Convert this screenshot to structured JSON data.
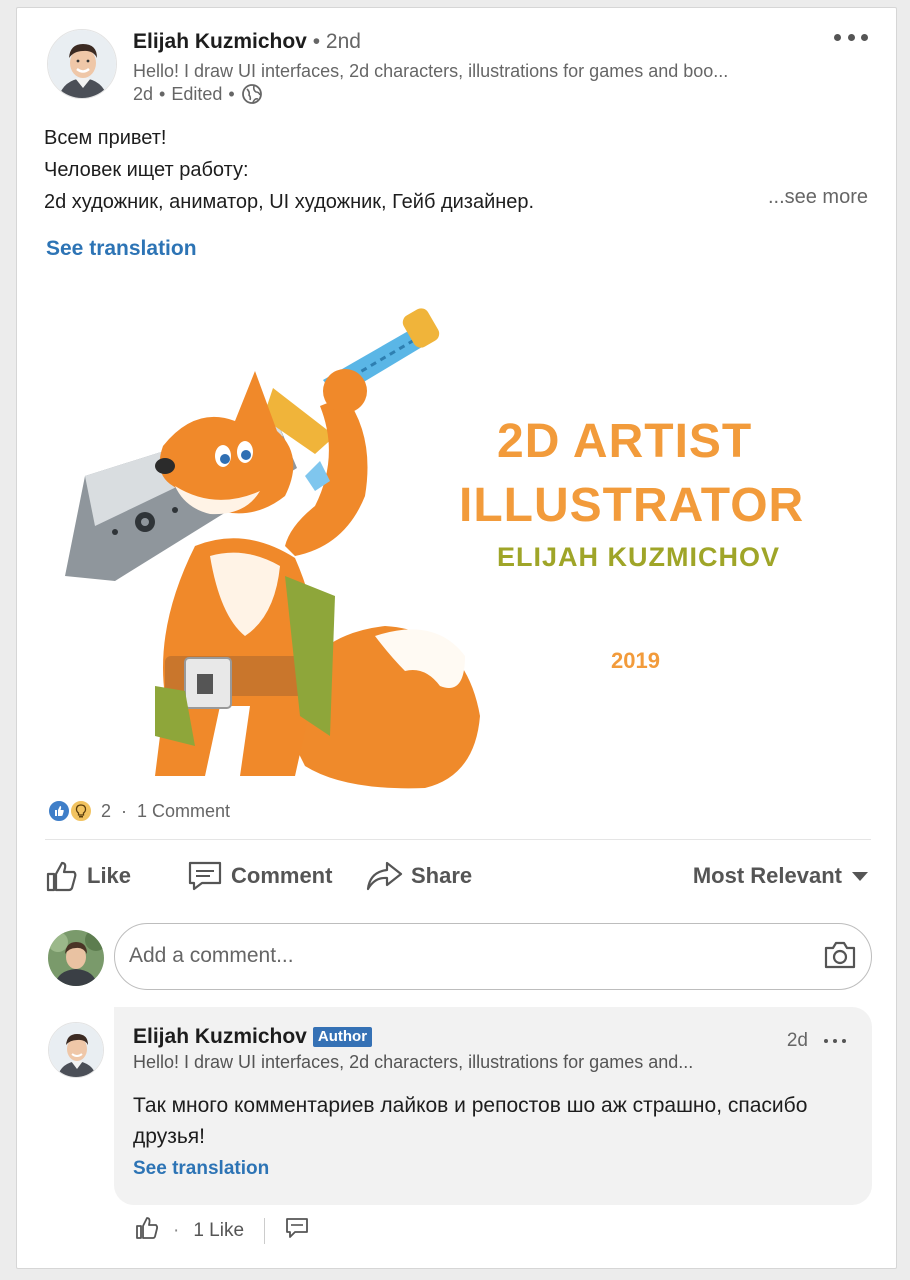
{
  "post": {
    "author": {
      "name": "Elijah Kuzmichov",
      "degree": " • 2nd",
      "headline": "Hello! I draw UI interfaces, 2d characters, illustrations for games and boo...",
      "time": "2d",
      "edited": "Edited"
    },
    "text": {
      "line1": "Всем привет!",
      "line2": "Человек ищет работу:",
      "line3": "2d художник, аниматор, UI художник, Гейб дизайнер."
    },
    "see_more": "...see more",
    "see_translation": "See translation",
    "image": {
      "title_line1": "2D ARTIST",
      "title_line2": "ILLUSTRATOR",
      "subtitle": "ELIJAH KUZMICHOV",
      "year": "2019"
    },
    "reactions": {
      "count": "2",
      "separator": "·",
      "comments": "1 Comment",
      "icons": [
        "like-icon",
        "insightful-icon"
      ]
    }
  },
  "actions": {
    "like": "Like",
    "comment": "Comment",
    "share": "Share",
    "sort": "Most Relevant"
  },
  "comment_input": {
    "placeholder": "Add a comment..."
  },
  "comment": {
    "author": "Elijah Kuzmichov",
    "badge": "Author",
    "headline": "Hello! I draw UI interfaces, 2d characters, illustrations for games and...",
    "time": "2d",
    "text": "Так много комментариев лайков и репостов шо аж страшно, спасибо друзья!",
    "see_translation": "See translation",
    "likes": "1 Like",
    "dot": "·"
  },
  "colors": {
    "link_blue": "#2d74b5",
    "badge_blue": "#3571b5",
    "image_orange": "#f29b3b",
    "image_olive": "#9fa528"
  }
}
